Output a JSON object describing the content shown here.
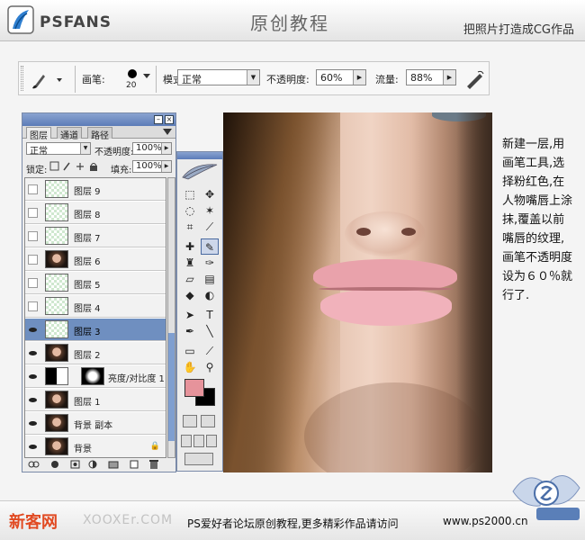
{
  "header": {
    "logo_text": "PSFANS",
    "title": "原创教程",
    "subtitle": "把照片打造成CG作品"
  },
  "options_bar": {
    "brush_label": "画笔:",
    "brush_size": "20",
    "mode_label": "模式:",
    "mode_value": "正常",
    "opacity_label": "不透明度:",
    "opacity_value": "60%",
    "flow_label": "流量:",
    "flow_value": "88%"
  },
  "layers_panel": {
    "tabs": [
      "图层",
      "通道",
      "路径"
    ],
    "blend_mode": "正常",
    "opacity_label": "不透明度:",
    "opacity_value": "100%",
    "lock_label": "锁定:",
    "fill_label": "填充:",
    "fill_value": "100%",
    "layers": [
      {
        "name": "图层 9",
        "visible": false,
        "thumb": "checker"
      },
      {
        "name": "图层 8",
        "visible": false,
        "thumb": "checker"
      },
      {
        "name": "图层 7",
        "visible": false,
        "thumb": "checker"
      },
      {
        "name": "图层 6",
        "visible": false,
        "thumb": "face"
      },
      {
        "name": "图层 5",
        "visible": false,
        "thumb": "checker"
      },
      {
        "name": "图层 4",
        "visible": false,
        "thumb": "checker"
      },
      {
        "name": "图层 3",
        "visible": true,
        "thumb": "checker",
        "selected": true
      },
      {
        "name": "图层 2",
        "visible": true,
        "thumb": "face"
      },
      {
        "name": "亮度/对比度 1",
        "visible": true,
        "thumb": "adj"
      },
      {
        "name": "图层 1",
        "visible": true,
        "thumb": "face"
      },
      {
        "name": "背景 副本",
        "visible": true,
        "thumb": "face"
      },
      {
        "name": "背景",
        "visible": true,
        "thumb": "face",
        "locked": true
      }
    ]
  },
  "tools": {
    "foreground_color": "#e6939b",
    "background_color": "#000000"
  },
  "caption": "新建一层,用画笔工具,选择粉红色,在人物嘴唇上涂抹,覆盖以前嘴唇的纹理,画笔不透明度设为６０％就行了.",
  "footer": {
    "site_name": "新客网",
    "ghost_url": "XOOXEr.COM",
    "note": "PS爱好者论坛原创教程,更多精彩作品请访问",
    "url": "www.ps2000.cn"
  }
}
